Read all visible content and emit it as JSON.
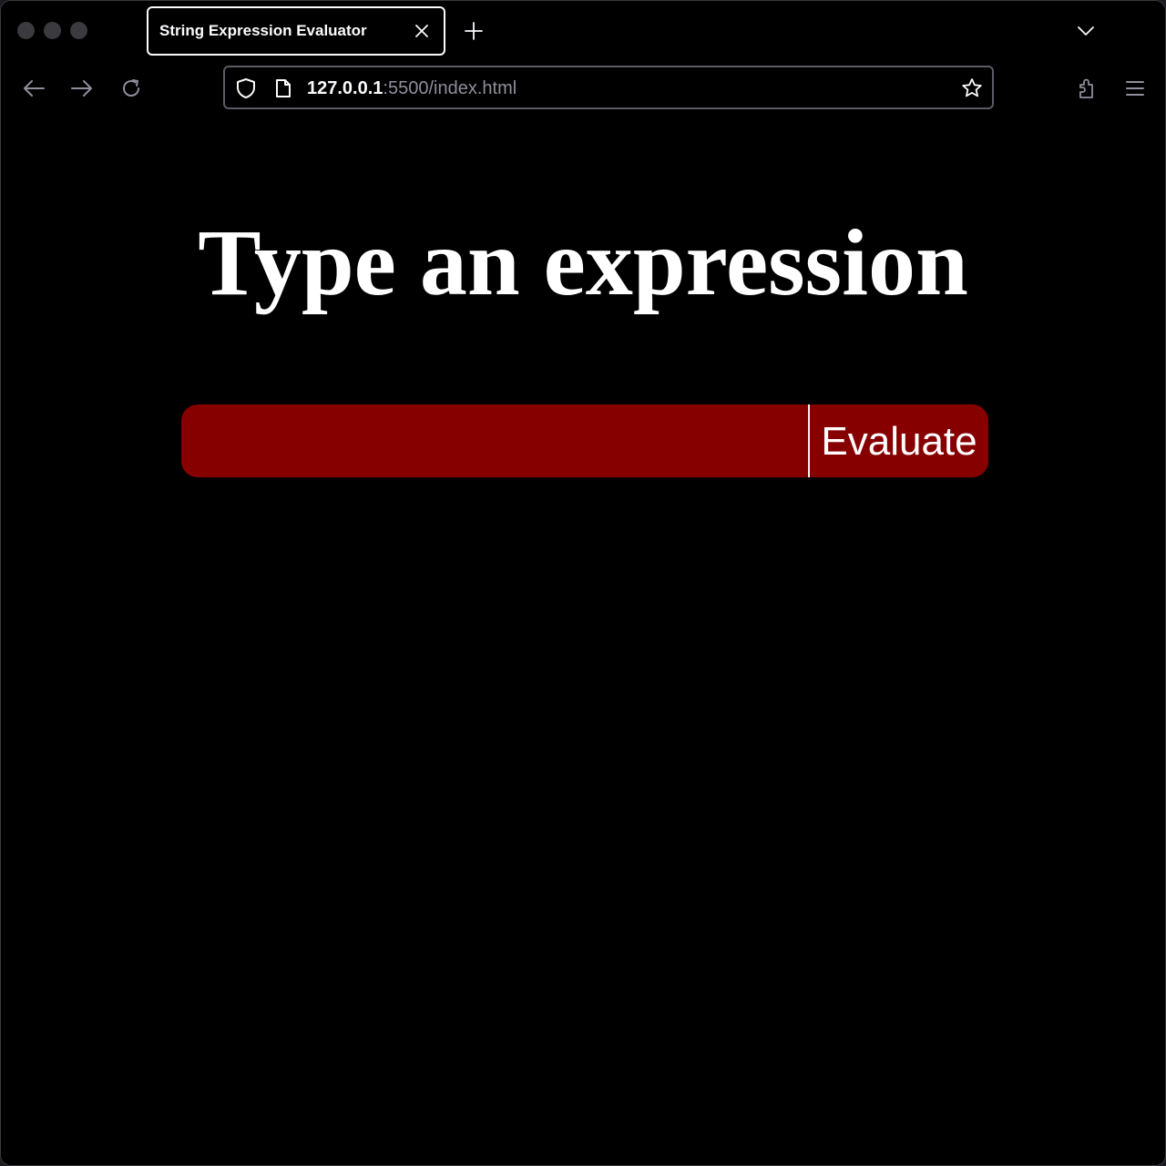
{
  "browser": {
    "tab": {
      "title": "String Expression Evaluator"
    },
    "url": {
      "host": "127.0.0.1",
      "path": ":5500/index.html"
    },
    "icons": {
      "back": "arrow-left-icon",
      "forward": "arrow-right-icon",
      "reload": "reload-icon",
      "shield": "shield-icon",
      "page": "page-icon",
      "star": "star-icon",
      "extensions": "extensions-icon",
      "menu": "hamburger-menu-icon",
      "new_tab": "plus-icon",
      "tab_list": "chevron-down-icon",
      "close": "close-icon"
    }
  },
  "page": {
    "heading": "Type an expression",
    "input": {
      "value": "",
      "placeholder": ""
    },
    "button_label": "Evaluate",
    "colors": {
      "form_bg": "#870000",
      "page_bg": "#000000",
      "text": "#ffffff"
    }
  }
}
